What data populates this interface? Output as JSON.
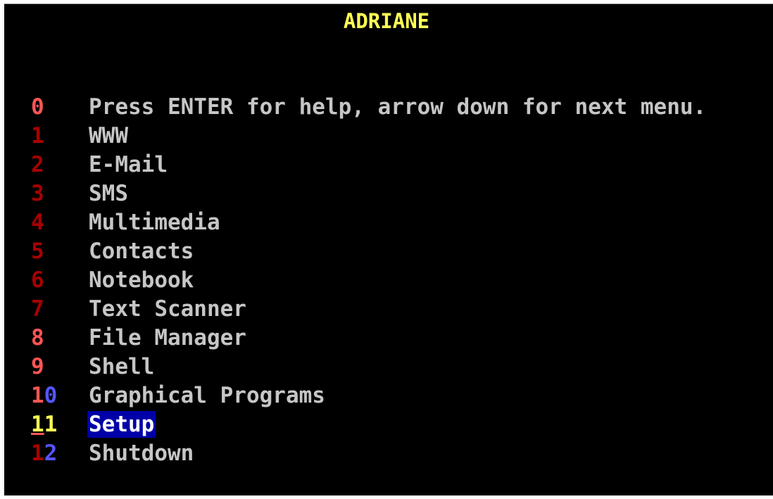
{
  "title": "ADRIANE",
  "colors": {
    "background": "#000000",
    "title": "#ffff55",
    "number_red": "#a80000",
    "number_red_bright": "#ff5555",
    "number_blue": "#5555ff",
    "number_selected": "#ffff55",
    "label": "#c6c6c6",
    "selection_bg": "#0000a8"
  },
  "menu": {
    "selected_index": 11,
    "items": [
      {
        "number": "0",
        "label": "Press ENTER for help, arrow down for next menu."
      },
      {
        "number": "1",
        "label": "WWW"
      },
      {
        "number": "2",
        "label": "E-Mail"
      },
      {
        "number": "3",
        "label": "SMS"
      },
      {
        "number": "4",
        "label": "Multimedia"
      },
      {
        "number": "5",
        "label": "Contacts"
      },
      {
        "number": "6",
        "label": "Notebook"
      },
      {
        "number": "7",
        "label": "Text Scanner"
      },
      {
        "number": "8",
        "label": "File Manager"
      },
      {
        "number": "9",
        "label": "Shell"
      },
      {
        "number": "10",
        "label": "Graphical Programs"
      },
      {
        "number": "11",
        "label": "Setup"
      },
      {
        "number": "12",
        "label": "Shutdown"
      }
    ]
  }
}
